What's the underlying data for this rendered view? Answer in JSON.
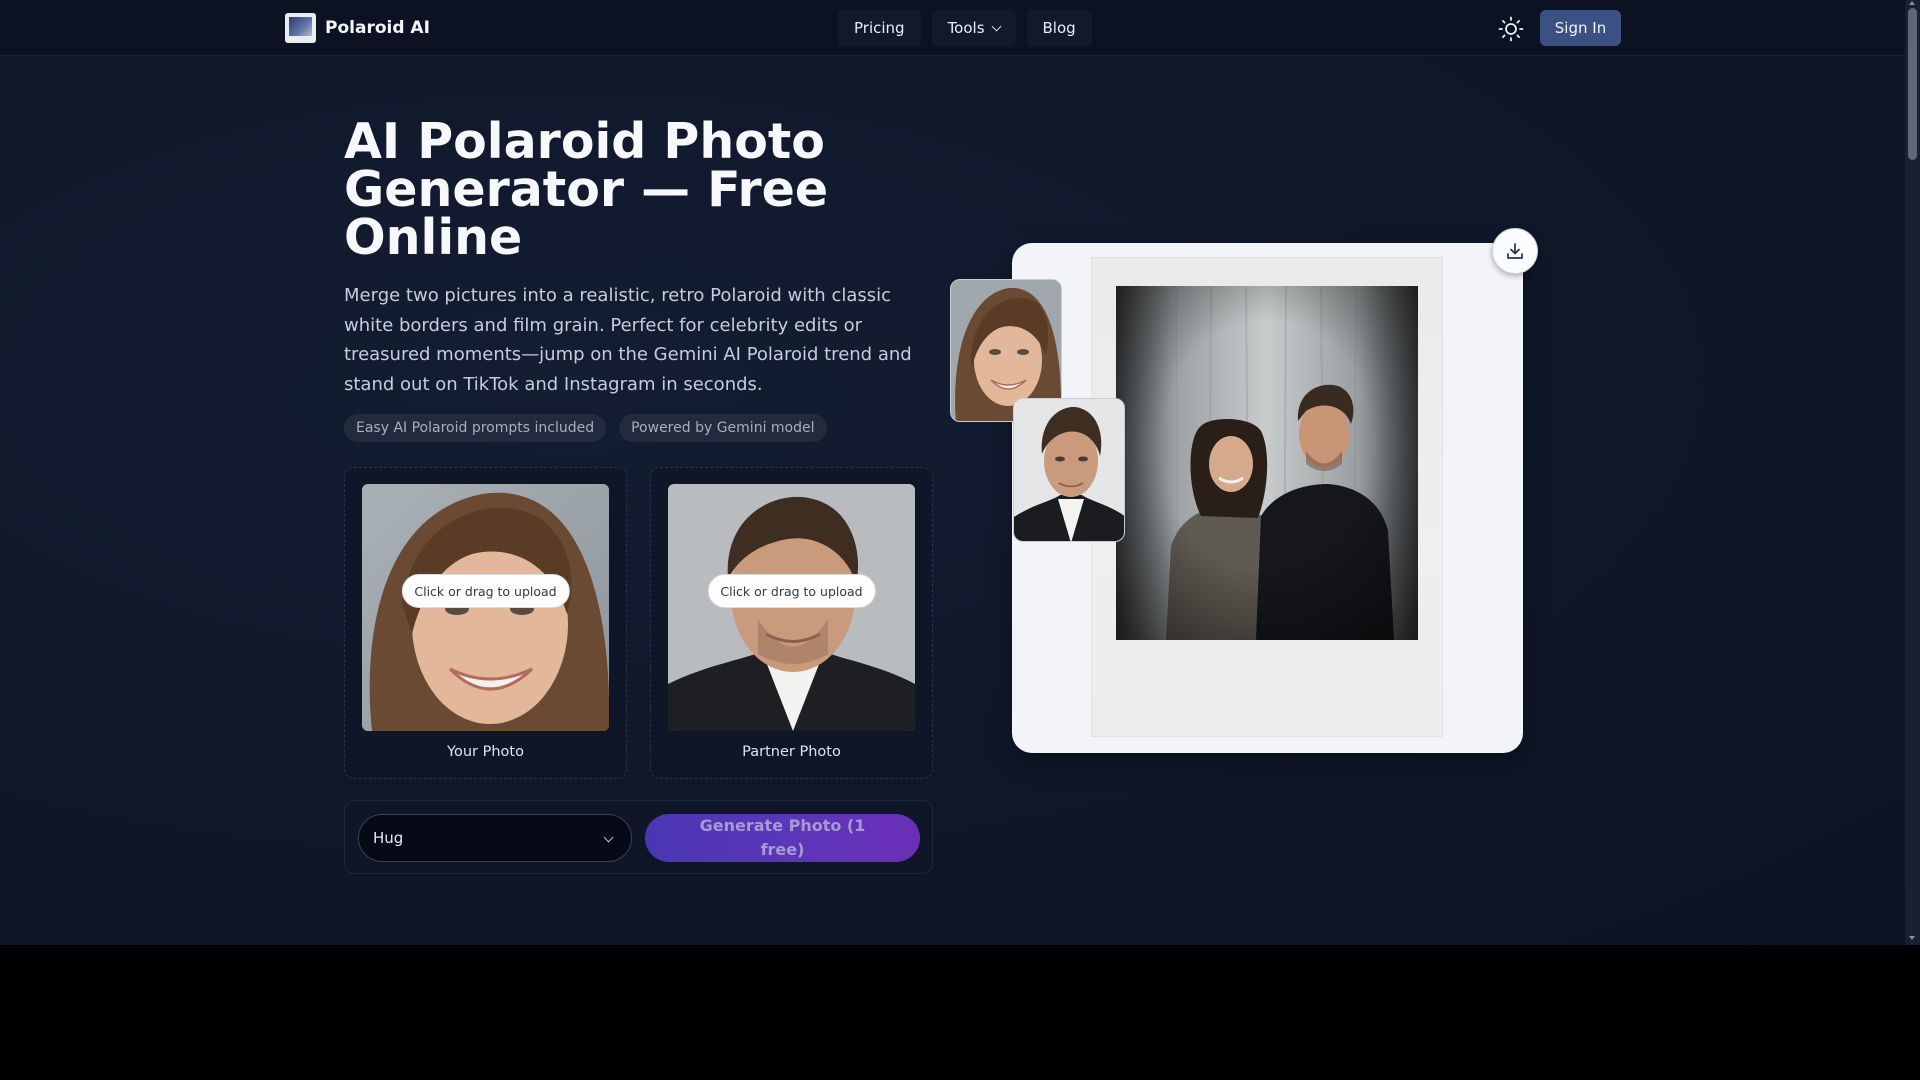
{
  "header": {
    "brand": "Polaroid AI",
    "nav": [
      {
        "label": "Pricing"
      },
      {
        "label": "Tools"
      },
      {
        "label": "Blog"
      }
    ],
    "sign_in": "Sign In"
  },
  "hero": {
    "title": "AI Polaroid Photo Generator — Free Online",
    "subtitle": "Merge two pictures into a realistic, retro Polaroid with classic white borders and film grain. Perfect for celebrity edits or treasured moments—jump on the Gemini AI Polaroid trend and stand out on TikTok and Instagram in seconds.",
    "tags": [
      "Easy AI Polaroid prompts included",
      "Powered by Gemini model"
    ]
  },
  "uploads": [
    {
      "button": "Click or drag to upload",
      "label": "Your Photo"
    },
    {
      "button": "Click or drag to upload",
      "label": "Partner Photo"
    }
  ],
  "controls": {
    "pose_value": "Hug",
    "generate_label": "Generate Photo (1 free)"
  },
  "icons": {
    "theme": "sun-icon",
    "download": "download-icon",
    "chevron": "chevron-down-icon",
    "logo": "polaroid-logo-icon"
  },
  "colors": {
    "background": "#0f1729",
    "header": "#0b1222",
    "sign_in": "#3c5183",
    "generate_gradient_start": "#4a36b4",
    "generate_gradient_end": "#6b2fb8",
    "card": "#f3f4f7"
  }
}
